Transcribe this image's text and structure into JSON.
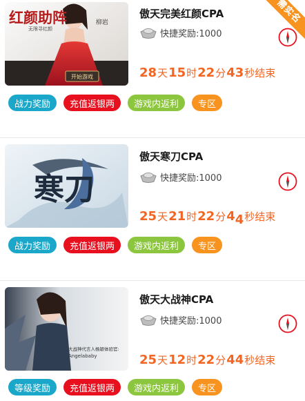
{
  "colors": {
    "orange": "#f26522",
    "tag_cyan": "#1aa7c9",
    "tag_red": "#e8101f",
    "tag_green": "#8cc63f",
    "tag_orange": "#f7931e"
  },
  "ribbon": {
    "label": "需实名"
  },
  "cards": [
    {
      "title": "傲天完美红颜CPA",
      "reward": "快捷奖励:1000",
      "countdown": {
        "days": "28",
        "day_unit": "天",
        "hours": "15",
        "hour_unit": "时",
        "minutes": "22",
        "minute_unit": "分",
        "seconds": "43",
        "second_unit": "秒结束"
      },
      "thumb": {
        "brand": "红颜助阵",
        "sub": "无限寻红颜",
        "btn": "开始游戏",
        "side": "柳岩"
      },
      "tags": [
        {
          "label": "战力奖励",
          "color": "cyan"
        },
        {
          "label": "充值返银两",
          "color": "red"
        },
        {
          "label": "游戏内返利",
          "color": "green"
        },
        {
          "label": "专区",
          "color": "orange"
        }
      ]
    },
    {
      "title": "傲天寒刀CPA",
      "reward": "快捷奖励:1000",
      "countdown": {
        "days": "25",
        "day_unit": "天",
        "hours": "21",
        "hour_unit": "时",
        "minutes": "22",
        "minute_unit": "分",
        "seconds_a": "4",
        "seconds_b": "4",
        "second_unit": "秒结束"
      },
      "thumb": {
        "logo": "寒刀"
      },
      "tags": [
        {
          "label": "战力奖励",
          "color": "cyan"
        },
        {
          "label": "充值返银两",
          "color": "red"
        },
        {
          "label": "游戏内返利",
          "color": "green"
        },
        {
          "label": "专区",
          "color": "orange"
        }
      ]
    },
    {
      "title": "傲天大战神CPA",
      "reward": "快捷奖励:1000",
      "countdown": {
        "days": "25",
        "day_unit": "天",
        "hours": "12",
        "hour_unit": "时",
        "minutes": "22",
        "minute_unit": "分",
        "seconds": "44",
        "second_unit": "秒结束"
      },
      "thumb": {
        "caption1": "大战神代言人杨颖体验官:",
        "caption2": "Angelababy"
      },
      "tags": [
        {
          "label": "等级奖励",
          "color": "cyan"
        },
        {
          "label": "充值返银两",
          "color": "red"
        },
        {
          "label": "游戏内返利",
          "color": "green"
        },
        {
          "label": "专区",
          "color": "orange"
        }
      ]
    }
  ]
}
